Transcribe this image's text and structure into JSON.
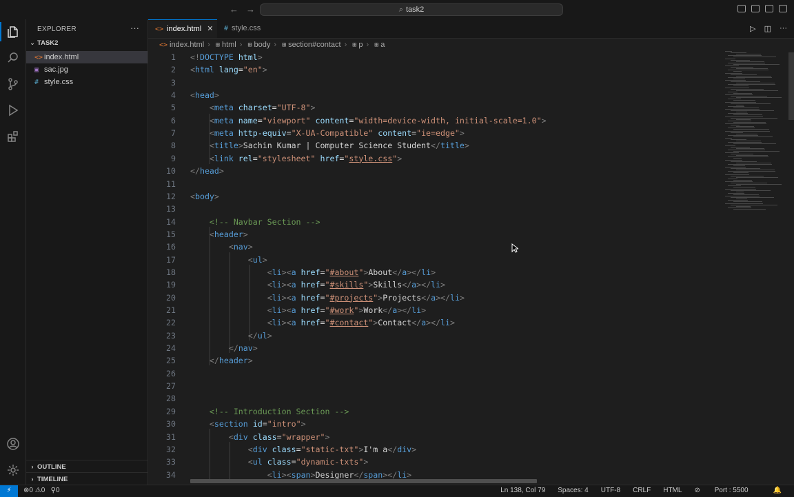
{
  "titlebar": {
    "search_text": "task2"
  },
  "explorer": {
    "title": "EXPLORER",
    "more": "···",
    "folder": "TASK2",
    "files": [
      {
        "name": "index.html",
        "icon": "<>",
        "type": "html",
        "selected": true
      },
      {
        "name": "sac.jpg",
        "icon": "▣",
        "type": "img",
        "selected": false
      },
      {
        "name": "style.css",
        "icon": "#",
        "type": "css",
        "selected": false
      }
    ],
    "outline": "OUTLINE",
    "timeline": "TIMELINE"
  },
  "tabs": [
    {
      "label": "index.html",
      "icon": "<>",
      "active": true
    },
    {
      "label": "style.css",
      "icon": "#",
      "active": false
    }
  ],
  "breadcrumb": [
    "index.html",
    "html",
    "body",
    "section#contact",
    "p",
    "a"
  ],
  "code_lines": [
    {
      "n": "1",
      "t": [
        [
          "p",
          "<!"
        ],
        [
          "tag",
          "DOCTYPE"
        ],
        [
          "attr",
          " html"
        ],
        [
          "p",
          ">"
        ]
      ]
    },
    {
      "n": "2",
      "t": [
        [
          "p",
          "<"
        ],
        [
          "tag",
          "html"
        ],
        [
          "attr",
          " lang"
        ],
        [
          "txt",
          "="
        ],
        [
          "str",
          "\"en\""
        ],
        [
          "p",
          ">"
        ]
      ]
    },
    {
      "n": "3",
      "t": []
    },
    {
      "n": "4",
      "t": [
        [
          "p",
          "<"
        ],
        [
          "tag",
          "head"
        ],
        [
          "p",
          ">"
        ]
      ]
    },
    {
      "n": "5",
      "t": [
        [
          "txt",
          "    "
        ],
        [
          "p",
          "<"
        ],
        [
          "tag",
          "meta"
        ],
        [
          "attr",
          " charset"
        ],
        [
          "txt",
          "="
        ],
        [
          "str",
          "\"UTF-8\""
        ],
        [
          "p",
          ">"
        ]
      ]
    },
    {
      "n": "6",
      "t": [
        [
          "txt",
          "    "
        ],
        [
          "p",
          "<"
        ],
        [
          "tag",
          "meta"
        ],
        [
          "attr",
          " name"
        ],
        [
          "txt",
          "="
        ],
        [
          "str",
          "\"viewport\""
        ],
        [
          "attr",
          " content"
        ],
        [
          "txt",
          "="
        ],
        [
          "str",
          "\"width=device-width, initial-scale=1.0\""
        ],
        [
          "p",
          ">"
        ]
      ]
    },
    {
      "n": "7",
      "t": [
        [
          "txt",
          "    "
        ],
        [
          "p",
          "<"
        ],
        [
          "tag",
          "meta"
        ],
        [
          "attr",
          " http-equiv"
        ],
        [
          "txt",
          "="
        ],
        [
          "str",
          "\"X-UA-Compatible\""
        ],
        [
          "attr",
          " content"
        ],
        [
          "txt",
          "="
        ],
        [
          "str",
          "\"ie=edge\""
        ],
        [
          "p",
          ">"
        ]
      ]
    },
    {
      "n": "8",
      "t": [
        [
          "txt",
          "    "
        ],
        [
          "p",
          "<"
        ],
        [
          "tag",
          "title"
        ],
        [
          "p",
          ">"
        ],
        [
          "txt",
          "Sachin Kumar | Computer Science Student"
        ],
        [
          "p",
          "</"
        ],
        [
          "tag",
          "title"
        ],
        [
          "p",
          ">"
        ]
      ]
    },
    {
      "n": "9",
      "t": [
        [
          "txt",
          "    "
        ],
        [
          "p",
          "<"
        ],
        [
          "tag",
          "link"
        ],
        [
          "attr",
          " rel"
        ],
        [
          "txt",
          "="
        ],
        [
          "str",
          "\"stylesheet\""
        ],
        [
          "attr",
          " href"
        ],
        [
          "txt",
          "="
        ],
        [
          "str",
          "\""
        ],
        [
          "link",
          "style.css"
        ],
        [
          "str",
          "\""
        ],
        [
          "p",
          ">"
        ]
      ]
    },
    {
      "n": "10",
      "t": [
        [
          "p",
          "</"
        ],
        [
          "tag",
          "head"
        ],
        [
          "p",
          ">"
        ]
      ]
    },
    {
      "n": "11",
      "t": []
    },
    {
      "n": "12",
      "t": [
        [
          "p",
          "<"
        ],
        [
          "tag",
          "body"
        ],
        [
          "p",
          ">"
        ]
      ]
    },
    {
      "n": "13",
      "t": []
    },
    {
      "n": "14",
      "t": [
        [
          "txt",
          "    "
        ],
        [
          "com",
          "<!-- Navbar Section -->"
        ]
      ]
    },
    {
      "n": "15",
      "t": [
        [
          "txt",
          "    "
        ],
        [
          "p",
          "<"
        ],
        [
          "tag",
          "header"
        ],
        [
          "p",
          ">"
        ]
      ]
    },
    {
      "n": "16",
      "t": [
        [
          "txt",
          "        "
        ],
        [
          "p",
          "<"
        ],
        [
          "tag",
          "nav"
        ],
        [
          "p",
          ">"
        ]
      ]
    },
    {
      "n": "17",
      "t": [
        [
          "txt",
          "            "
        ],
        [
          "p",
          "<"
        ],
        [
          "tag",
          "ul"
        ],
        [
          "p",
          ">"
        ]
      ]
    },
    {
      "n": "18",
      "t": [
        [
          "txt",
          "                "
        ],
        [
          "p",
          "<"
        ],
        [
          "tag",
          "li"
        ],
        [
          "p",
          "><"
        ],
        [
          "tag",
          "a"
        ],
        [
          "attr",
          " href"
        ],
        [
          "txt",
          "="
        ],
        [
          "str",
          "\""
        ],
        [
          "link",
          "#about"
        ],
        [
          "str",
          "\""
        ],
        [
          "p",
          ">"
        ],
        [
          "txt",
          "About"
        ],
        [
          "p",
          "</"
        ],
        [
          "tag",
          "a"
        ],
        [
          "p",
          "></"
        ],
        [
          "tag",
          "li"
        ],
        [
          "p",
          ">"
        ]
      ]
    },
    {
      "n": "19",
      "t": [
        [
          "txt",
          "                "
        ],
        [
          "p",
          "<"
        ],
        [
          "tag",
          "li"
        ],
        [
          "p",
          "><"
        ],
        [
          "tag",
          "a"
        ],
        [
          "attr",
          " href"
        ],
        [
          "txt",
          "="
        ],
        [
          "str",
          "\""
        ],
        [
          "link",
          "#skills"
        ],
        [
          "str",
          "\""
        ],
        [
          "p",
          ">"
        ],
        [
          "txt",
          "Skills"
        ],
        [
          "p",
          "</"
        ],
        [
          "tag",
          "a"
        ],
        [
          "p",
          "></"
        ],
        [
          "tag",
          "li"
        ],
        [
          "p",
          ">"
        ]
      ]
    },
    {
      "n": "20",
      "t": [
        [
          "txt",
          "                "
        ],
        [
          "p",
          "<"
        ],
        [
          "tag",
          "li"
        ],
        [
          "p",
          "><"
        ],
        [
          "tag",
          "a"
        ],
        [
          "attr",
          " href"
        ],
        [
          "txt",
          "="
        ],
        [
          "str",
          "\""
        ],
        [
          "link",
          "#projects"
        ],
        [
          "str",
          "\""
        ],
        [
          "p",
          ">"
        ],
        [
          "txt",
          "Projects"
        ],
        [
          "p",
          "</"
        ],
        [
          "tag",
          "a"
        ],
        [
          "p",
          "></"
        ],
        [
          "tag",
          "li"
        ],
        [
          "p",
          ">"
        ]
      ]
    },
    {
      "n": "21",
      "t": [
        [
          "txt",
          "                "
        ],
        [
          "p",
          "<"
        ],
        [
          "tag",
          "li"
        ],
        [
          "p",
          "><"
        ],
        [
          "tag",
          "a"
        ],
        [
          "attr",
          " href"
        ],
        [
          "txt",
          "="
        ],
        [
          "str",
          "\""
        ],
        [
          "link",
          "#work"
        ],
        [
          "str",
          "\""
        ],
        [
          "p",
          ">"
        ],
        [
          "txt",
          "Work"
        ],
        [
          "p",
          "</"
        ],
        [
          "tag",
          "a"
        ],
        [
          "p",
          "></"
        ],
        [
          "tag",
          "li"
        ],
        [
          "p",
          ">"
        ]
      ]
    },
    {
      "n": "22",
      "t": [
        [
          "txt",
          "                "
        ],
        [
          "p",
          "<"
        ],
        [
          "tag",
          "li"
        ],
        [
          "p",
          "><"
        ],
        [
          "tag",
          "a"
        ],
        [
          "attr",
          " href"
        ],
        [
          "txt",
          "="
        ],
        [
          "str",
          "\""
        ],
        [
          "link",
          "#contact"
        ],
        [
          "str",
          "\""
        ],
        [
          "p",
          ">"
        ],
        [
          "txt",
          "Contact"
        ],
        [
          "p",
          "</"
        ],
        [
          "tag",
          "a"
        ],
        [
          "p",
          "></"
        ],
        [
          "tag",
          "li"
        ],
        [
          "p",
          ">"
        ]
      ]
    },
    {
      "n": "23",
      "t": [
        [
          "txt",
          "            "
        ],
        [
          "p",
          "</"
        ],
        [
          "tag",
          "ul"
        ],
        [
          "p",
          ">"
        ]
      ]
    },
    {
      "n": "24",
      "t": [
        [
          "txt",
          "        "
        ],
        [
          "p",
          "</"
        ],
        [
          "tag",
          "nav"
        ],
        [
          "p",
          ">"
        ]
      ]
    },
    {
      "n": "25",
      "t": [
        [
          "txt",
          "    "
        ],
        [
          "p",
          "</"
        ],
        [
          "tag",
          "header"
        ],
        [
          "p",
          ">"
        ]
      ]
    },
    {
      "n": "26",
      "t": []
    },
    {
      "n": "27",
      "t": []
    },
    {
      "n": "28",
      "t": []
    },
    {
      "n": "29",
      "t": [
        [
          "txt",
          "    "
        ],
        [
          "com",
          "<!-- Introduction Section -->"
        ]
      ]
    },
    {
      "n": "30",
      "t": [
        [
          "txt",
          "    "
        ],
        [
          "p",
          "<"
        ],
        [
          "tag",
          "section"
        ],
        [
          "attr",
          " id"
        ],
        [
          "txt",
          "="
        ],
        [
          "str",
          "\"intro\""
        ],
        [
          "p",
          ">"
        ]
      ]
    },
    {
      "n": "31",
      "t": [
        [
          "txt",
          "        "
        ],
        [
          "p",
          "<"
        ],
        [
          "tag",
          "div"
        ],
        [
          "attr",
          " class"
        ],
        [
          "txt",
          "="
        ],
        [
          "str",
          "\"wrapper\""
        ],
        [
          "p",
          ">"
        ]
      ]
    },
    {
      "n": "32",
      "t": [
        [
          "txt",
          "            "
        ],
        [
          "p",
          "<"
        ],
        [
          "tag",
          "div"
        ],
        [
          "attr",
          " class"
        ],
        [
          "txt",
          "="
        ],
        [
          "str",
          "\"static-txt\""
        ],
        [
          "p",
          ">"
        ],
        [
          "txt",
          "I'm a"
        ],
        [
          "p",
          "</"
        ],
        [
          "tag",
          "div"
        ],
        [
          "p",
          ">"
        ]
      ]
    },
    {
      "n": "33",
      "t": [
        [
          "txt",
          "            "
        ],
        [
          "p",
          "<"
        ],
        [
          "tag",
          "ul"
        ],
        [
          "attr",
          " class"
        ],
        [
          "txt",
          "="
        ],
        [
          "str",
          "\"dynamic-txts\""
        ],
        [
          "p",
          ">"
        ]
      ]
    },
    {
      "n": "34",
      "t": [
        [
          "txt",
          "                "
        ],
        [
          "p",
          "<"
        ],
        [
          "tag",
          "li"
        ],
        [
          "p",
          "><"
        ],
        [
          "tag",
          "span"
        ],
        [
          "p",
          ">"
        ],
        [
          "txt",
          "Designer"
        ],
        [
          "p",
          "</"
        ],
        [
          "tag",
          "span"
        ],
        [
          "p",
          "></"
        ],
        [
          "tag",
          "li"
        ],
        [
          "p",
          ">"
        ]
      ]
    }
  ],
  "status": {
    "errors": "0",
    "warnings": "0",
    "ports": "0",
    "position": "Ln 138, Col 79",
    "spaces": "Spaces: 4",
    "encoding": "UTF-8",
    "eol": "CRLF",
    "language": "HTML",
    "port": "Port : 5500"
  },
  "colors": {
    "accent": "#0078d4",
    "tag": "#569cd6",
    "attr": "#9cdcfe",
    "string": "#ce9178",
    "comment": "#6a9955"
  }
}
